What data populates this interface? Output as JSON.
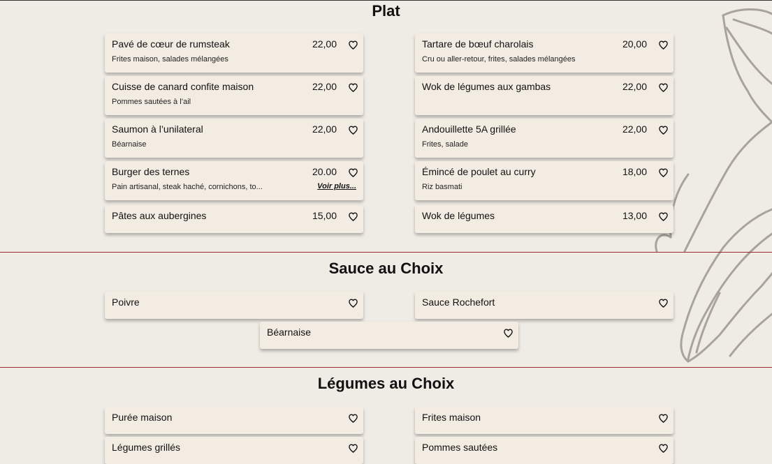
{
  "sections": [
    {
      "title": "Plat",
      "items": [
        {
          "name": "Pavé de cœur de rumsteak",
          "price": "22,00",
          "description": "Frites maison, salades mélangées"
        },
        {
          "name": "Tartare de bœuf charolais",
          "price": "20,00",
          "description": "Cru ou aller-retour, frites, salades mélangées"
        },
        {
          "name": "Cuisse de canard confite maison",
          "price": "22,00",
          "description": "Pommes sautées à l’ail"
        },
        {
          "name": "Wok de légumes aux gambas",
          "price": "22,00",
          "description": ""
        },
        {
          "name": "Saumon à l’unilateral",
          "price": "22,00",
          "description": "Béarnaise"
        },
        {
          "name": "Andouillette 5A grillée",
          "price": "22,00",
          "description": "Frites, salade"
        },
        {
          "name": "Burger des ternes",
          "price": "20.00",
          "description": "Pain artisanal, steak haché, cornichons, to...",
          "more": "Voir plus..."
        },
        {
          "name": "Émincé de poulet au curry",
          "price": "18,00",
          "description": "Riz basmati"
        },
        {
          "name": "Pâtes aux aubergines",
          "price": "15,00",
          "description": ""
        },
        {
          "name": "Wok de légumes",
          "price": "13,00",
          "description": ""
        }
      ]
    },
    {
      "title": "Sauce au Choix",
      "items": [
        {
          "name": "Poivre"
        },
        {
          "name": "Sauce Rochefort"
        },
        {
          "name": "Béarnaise"
        }
      ]
    },
    {
      "title": "Légumes au Choix",
      "items": [
        {
          "name": "Purée maison"
        },
        {
          "name": "Frites maison"
        },
        {
          "name": "Légumes grillés"
        },
        {
          "name": "Pommes sautées"
        }
      ]
    }
  ],
  "icons": {
    "favorite": "heart-outline-icon",
    "decoration": "leaf-line-art"
  },
  "colors": {
    "background": "#efebe5",
    "card": "#f3ece3",
    "divider": "#9b2b2b",
    "decoration": "#a8a49c"
  }
}
